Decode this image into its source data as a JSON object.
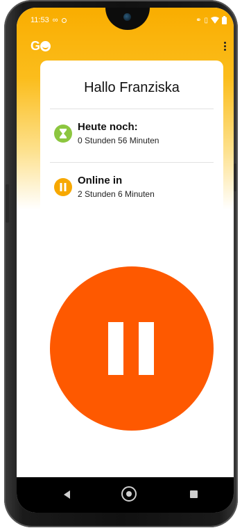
{
  "status_bar": {
    "time": "11:53",
    "icons_left": [
      "infinity-icon",
      "notification-icon"
    ],
    "icons_right": [
      "link-icon",
      "vibrate-icon",
      "wifi-icon",
      "battery-icon"
    ]
  },
  "app": {
    "logo_text": "G",
    "menu_icon": "more-vert-icon"
  },
  "card": {
    "greeting": "Hallo Franziska",
    "rows": [
      {
        "title": "Heute noch:",
        "subtitle": "0 Stunden 56 Minuten",
        "icon": "hourglass-icon",
        "color": "#8cc63f"
      },
      {
        "title": "Online in",
        "subtitle": "2 Stunden 6 Minuten",
        "icon": "pause-icon",
        "color": "#f7a800"
      }
    ]
  },
  "pause_button": {
    "icon": "pause-icon",
    "color": "#fe5900"
  },
  "colors": {
    "header": "#f9ad00",
    "accent": "#fe5900"
  },
  "navigation": {
    "back": "back-icon",
    "home": "home-icon",
    "recent": "recent-apps-icon"
  }
}
